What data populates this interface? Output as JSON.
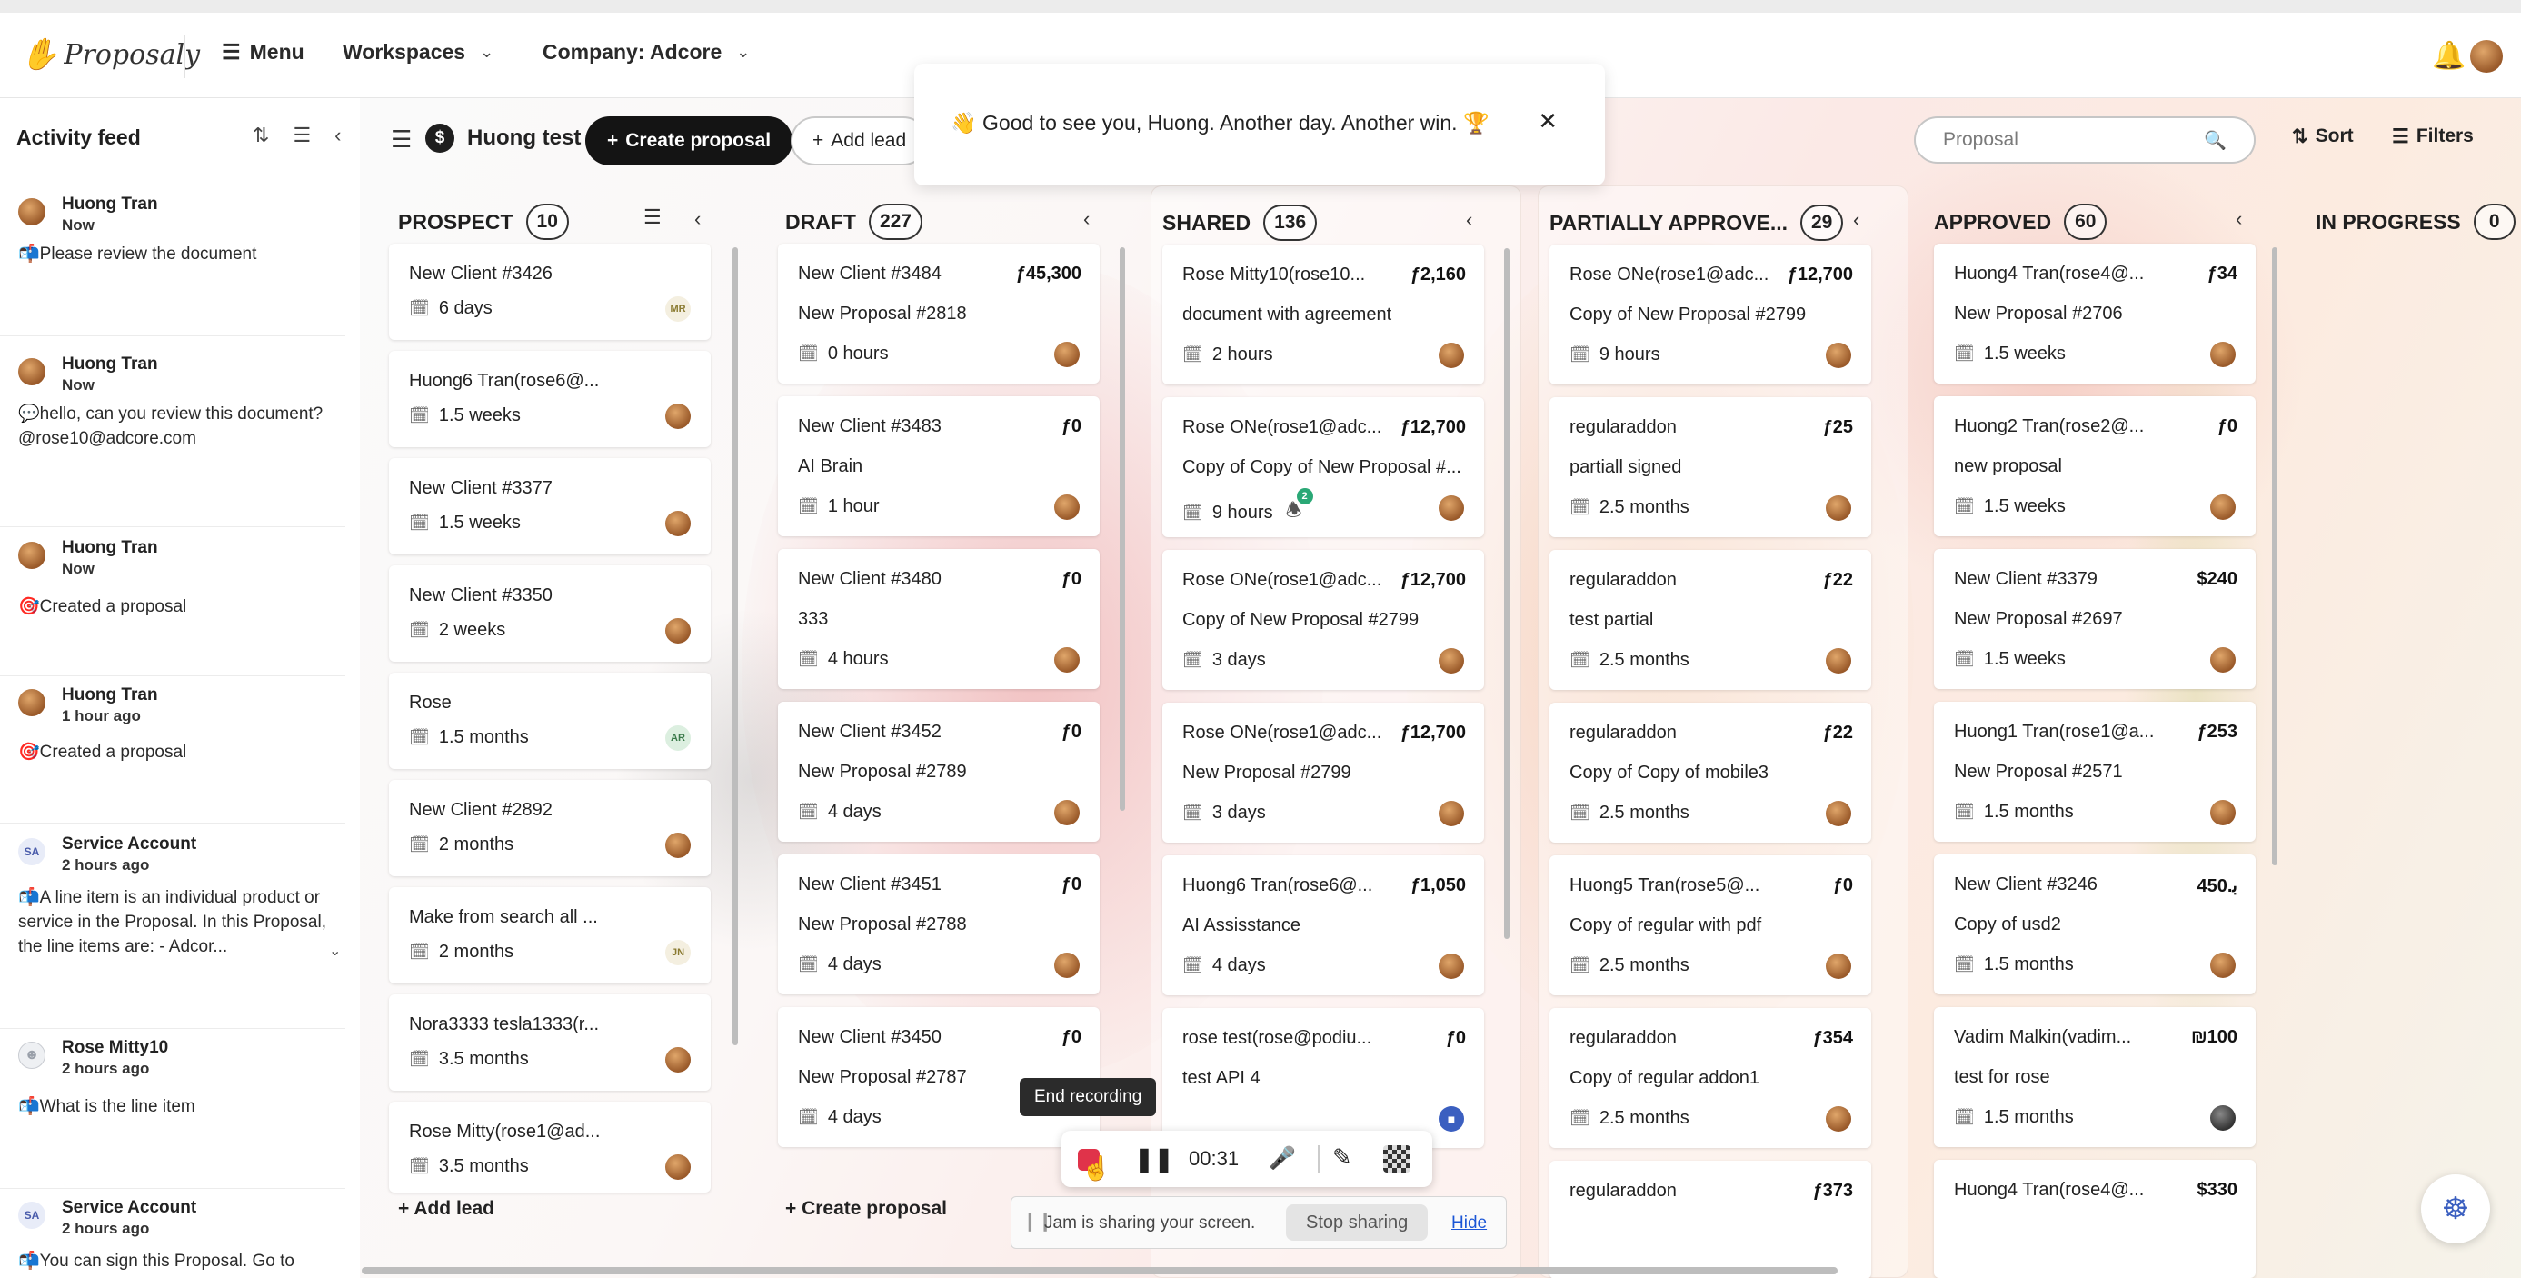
{
  "app": {
    "name": "Proposaly"
  },
  "nav": {
    "menu_label": "Menu",
    "workspaces_label": "Workspaces",
    "company_label": "Company: Adcore"
  },
  "activity": {
    "title": "Activity feed",
    "items": [
      {
        "name": "Huong Tran",
        "time": "Now",
        "emoji": "📬",
        "text": "Please review the document"
      },
      {
        "name": "Huong Tran",
        "time": "Now",
        "emoji": "💬",
        "text": "hello, can you review this document? @rose10@adcore.com"
      },
      {
        "name": "Huong Tran",
        "time": "Now",
        "emoji": "🎯",
        "text": "Created a proposal"
      },
      {
        "name": "Huong Tran",
        "time": "1 hour ago",
        "emoji": "🎯",
        "text": "Created a proposal"
      },
      {
        "name": "Service Account",
        "initials": "SA",
        "time": "2 hours ago",
        "emoji": "📬",
        "text": "A line item is an individual product or service in the Proposal. In this Proposal, the line items are: - Adcor..."
      },
      {
        "name": "Rose Mitty10",
        "time": "2 hours ago",
        "emoji": "📬",
        "text": "What is the line item"
      },
      {
        "name": "Service Account",
        "initials": "SA",
        "time": "2 hours ago",
        "emoji": "📬",
        "text": "You can sign this Proposal. Go to"
      }
    ]
  },
  "toolbar": {
    "workspace_name": "Huong test",
    "workspace_symbol": "$",
    "create_proposal": "Create proposal",
    "add_lead": "Add lead",
    "search_placeholder": "Proposal",
    "sort": "Sort",
    "filters": "Filters"
  },
  "toast": {
    "emoji": "👋",
    "message": "Good to see you, Huong. Another day. Another win.",
    "trophy": "🏆"
  },
  "columns": [
    {
      "title": "PROSPECT",
      "count": "10",
      "footer": "+ Add lead",
      "cards": [
        {
          "line1": "New Client #3426",
          "duration": "6 days",
          "avatar": "MR"
        },
        {
          "line1": "Huong6 Tran(rose6@...",
          "duration": "1.5 weeks"
        },
        {
          "line1": "New Client #3377",
          "duration": "1.5 weeks"
        },
        {
          "line1": "New Client #3350",
          "duration": "2 weeks"
        },
        {
          "line1": "Rose",
          "duration": "1.5 months",
          "avatar": "AR"
        },
        {
          "line1": "New Client #2892",
          "duration": "2 months"
        },
        {
          "line1": "Make from search all ...",
          "duration": "2 months",
          "avatar": "JN"
        },
        {
          "line1": "Nora3333 tesla1333(r...",
          "duration": "3.5 months"
        },
        {
          "line1": "Rose Mitty(rose1@ad...",
          "duration": "3.5 months"
        }
      ]
    },
    {
      "title": "DRAFT",
      "count": "227",
      "footer": "+ Create proposal",
      "cards": [
        {
          "line1": "New Client #3484",
          "amount": "ƒ45,300",
          "line2": "New Proposal #2818",
          "duration": "0 hours"
        },
        {
          "line1": "New Client #3483",
          "amount": "ƒ0",
          "line2": "AI Brain",
          "duration": "1 hour"
        },
        {
          "line1": "New Client #3480",
          "amount": "ƒ0",
          "line2": "333",
          "duration": "4 hours"
        },
        {
          "line1": "New Client #3452",
          "amount": "ƒ0",
          "line2": "New Proposal #2789",
          "duration": "4 days"
        },
        {
          "line1": "New Client #3451",
          "amount": "ƒ0",
          "line2": "New Proposal #2788",
          "duration": "4 days"
        },
        {
          "line1": "New Client #3450",
          "amount": "ƒ0",
          "line2": "New Proposal #2787",
          "duration": "4 days"
        }
      ]
    },
    {
      "title": "SHARED",
      "count": "136",
      "cards": [
        {
          "line1": "Rose Mitty10(rose10...",
          "amount": "ƒ2,160",
          "line2": "document with agreement",
          "duration": "2 hours"
        },
        {
          "line1": "Rose ONe(rose1@adc...",
          "amount": "ƒ12,700",
          "line2": "Copy of Copy of New Proposal #...",
          "duration": "9 hours",
          "bell_count": "2"
        },
        {
          "line1": "Rose ONe(rose1@adc...",
          "amount": "ƒ12,700",
          "line2": "Copy of New Proposal #2799",
          "duration": "3 days"
        },
        {
          "line1": "Rose ONe(rose1@adc...",
          "amount": "ƒ12,700",
          "line2": "New Proposal #2799",
          "duration": "3 days"
        },
        {
          "line1": "Huong6 Tran(rose6@...",
          "amount": "ƒ1,050",
          "line2": "AI Assisstance",
          "duration": "4 days"
        },
        {
          "line1": "rose test(rose@podiu...",
          "amount": "ƒ0",
          "line2": "test API 4",
          "duration": ""
        }
      ]
    },
    {
      "title": "PARTIALLY APPROVE...",
      "count": "29",
      "cards": [
        {
          "line1": "Rose ONe(rose1@adc...",
          "amount": "ƒ12,700",
          "line2": "Copy of New Proposal #2799",
          "duration": "9 hours"
        },
        {
          "line1": "regularaddon",
          "amount": "ƒ25",
          "line2": "partiall signed",
          "duration": "2.5 months"
        },
        {
          "line1": "regularaddon",
          "amount": "ƒ22",
          "line2": "test partial",
          "duration": "2.5 months"
        },
        {
          "line1": "regularaddon",
          "amount": "ƒ22",
          "line2": "Copy of Copy of mobile3",
          "duration": "2.5 months"
        },
        {
          "line1": "Huong5 Tran(rose5@...",
          "amount": "ƒ0",
          "line2": "Copy of regular with pdf",
          "duration": "2.5 months"
        },
        {
          "line1": "regularaddon",
          "amount": "ƒ354",
          "line2": "Copy of regular addon1",
          "duration": "2.5 months"
        },
        {
          "line1": "regularaddon",
          "amount": "ƒ373",
          "line2": "",
          "duration": ""
        }
      ]
    },
    {
      "title": "APPROVED",
      "count": "60",
      "cards": [
        {
          "line1": "Huong4 Tran(rose4@...",
          "amount": "ƒ34",
          "line2": "New Proposal #2706",
          "duration": "1.5 weeks"
        },
        {
          "line1": "Huong2 Tran(rose2@...",
          "amount": "ƒ0",
          "line2": "new proposal",
          "duration": "1.5 weeks"
        },
        {
          "line1": "New Client #3379",
          "amount": "$240",
          "line2": "New Proposal #2697",
          "duration": "1.5 weeks"
        },
        {
          "line1": "Huong1 Tran(rose1@a...",
          "amount": "ƒ253",
          "line2": "New Proposal #2571",
          "duration": "1.5 months"
        },
        {
          "line1": "New Client #3246",
          "amount": "450.ﺑ",
          "line2": "Copy of usd2",
          "duration": "1.5 months"
        },
        {
          "line1": "Vadim Malkin(vadim...",
          "amount": "₪100",
          "line2": "test for rose",
          "duration": "1.5 months"
        },
        {
          "line1": "Huong4 Tran(rose4@...",
          "amount": "$330",
          "line2": "",
          "duration": ""
        }
      ]
    },
    {
      "title": "IN PROGRESS",
      "count": "0",
      "cards": []
    }
  ],
  "recording": {
    "tooltip": "End recording",
    "time": "00:31",
    "share_text": "Jam is sharing your screen.",
    "stop_sharing": "Stop sharing",
    "hide": "Hide"
  }
}
